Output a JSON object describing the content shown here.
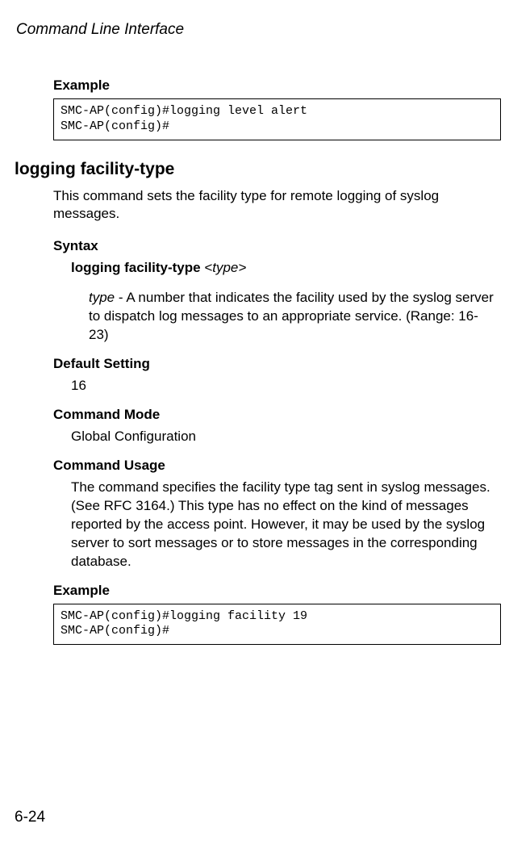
{
  "running_head": "Command Line Interface",
  "example1": {
    "label": "Example",
    "code": "SMC-AP(config)#logging level alert\nSMC-AP(config)#"
  },
  "command_title": "logging facility-type",
  "command_desc": "This command sets the facility type for remote logging of syslog messages.",
  "syntax": {
    "label": "Syntax",
    "line_bold": "logging facility-type ",
    "line_italic": "<type>",
    "param_name": "type",
    "param_sep": " - ",
    "param_desc": "A number that indicates the facility used by the syslog server to dispatch log messages to an appropriate service. (Range: 16-23)"
  },
  "default_setting": {
    "label": "Default Setting",
    "value": "16"
  },
  "command_mode": {
    "label": "Command Mode",
    "value": "Global Configuration"
  },
  "command_usage": {
    "label": "Command Usage",
    "text": "The command specifies the facility type tag sent in syslog messages. (See RFC 3164.) This type has no effect on the kind of messages reported by the access point. However, it may be used by the syslog server to sort messages or to store messages in the corresponding database."
  },
  "example2": {
    "label": "Example",
    "code": "SMC-AP(config)#logging facility 19\nSMC-AP(config)#"
  },
  "page_number": "6-24"
}
